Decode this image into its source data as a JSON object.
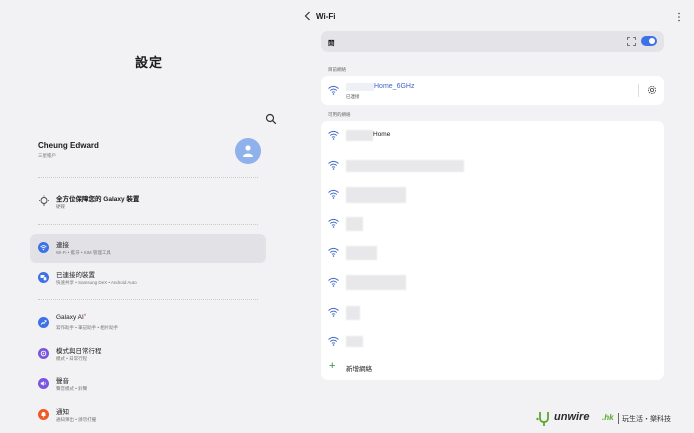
{
  "left": {
    "title": "設定",
    "profile": {
      "name": "Cheung Edward",
      "sub": "三星帳戶"
    },
    "protect": {
      "title": "全方位保障您的 Galaxy 裝置",
      "sub": "硬碟"
    },
    "menu": [
      {
        "title": "連接",
        "sub": "Wi-Fi • 藍牙 • SIM 管理工具",
        "color": "#3e71e6",
        "active": true,
        "icon": "wifi-icon"
      },
      {
        "title": "已連接的裝置",
        "sub": "快速共享 • Samsung DeX • Android Auto",
        "color": "#3e71e6",
        "active": false,
        "icon": "devices-icon"
      },
      {
        "title": "Galaxy AI",
        "star": "*",
        "sub": "寫作助手 • 筆記助手 • 相片助手",
        "color": "#3e71e6",
        "active": false,
        "icon": "ai-icon"
      },
      {
        "title": "模式與日常行程",
        "sub": "模式 • 日常行程",
        "color": "#7a56e0",
        "active": false,
        "icon": "modes-icon"
      },
      {
        "title": "聲音",
        "sub": "聲音模式 • 鈴聲",
        "color": "#7a56e0",
        "active": false,
        "icon": "sound-icon"
      },
      {
        "title": "通知",
        "sub": "通知彈出 • 請勿打擾",
        "color": "#ee5a24",
        "active": false,
        "icon": "bell-icon"
      }
    ]
  },
  "right": {
    "title": "Wi-Fi",
    "toggle_label": "開",
    "toggle_on": true,
    "current_label": "目前網絡",
    "current": {
      "name": "Home_6GHz",
      "status": "已連接"
    },
    "available_label": "可用的網絡",
    "networks": [
      {
        "name": "Home"
      },
      {
        "name": ""
      },
      {
        "name": ""
      },
      {
        "name": ""
      },
      {
        "name": ""
      },
      {
        "name": ""
      },
      {
        "name": ""
      },
      {
        "name": ""
      }
    ],
    "add_label": "新增網絡"
  },
  "logo": {
    "main": "unwire",
    "hk": ".hk",
    "sub": "玩生活・樂科技"
  },
  "colors": {
    "accent": "#3e71e6",
    "background": "#f2f2f4",
    "card": "#ffffff"
  }
}
